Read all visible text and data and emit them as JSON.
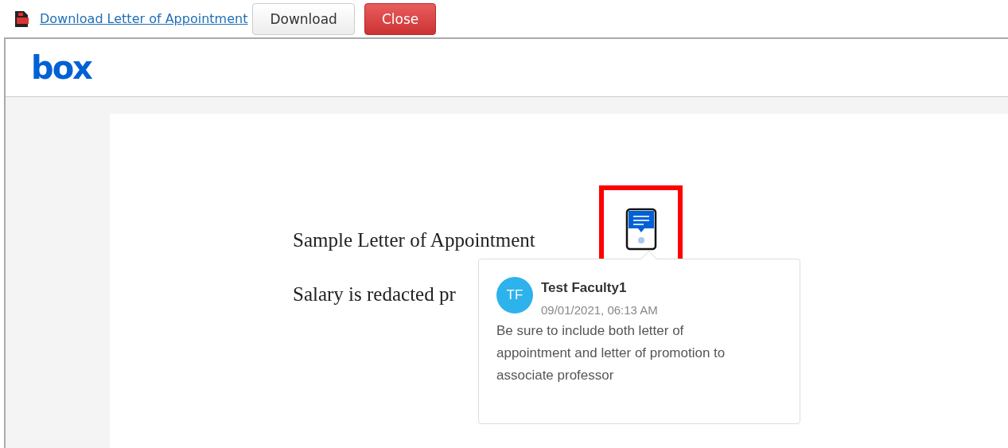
{
  "toolbar": {
    "link": "Download Letter of Appointment",
    "buttons": [
      {
        "label": "Download",
        "kind": "default"
      },
      {
        "label": "Close",
        "kind": "danger"
      }
    ]
  },
  "viewer": {
    "logo": "box"
  },
  "document": {
    "lines": [
      "Sample Letter of Appointment",
      "Salary is redacted pr"
    ]
  },
  "annotation": {
    "highlighted": true,
    "comment": {
      "initials": "TF",
      "author": "Test Faculty1",
      "time": "09/01/2021, 06:13 AM",
      "text": "Be sure to include both letter of appointment and letter of promotion to associate professor"
    }
  }
}
